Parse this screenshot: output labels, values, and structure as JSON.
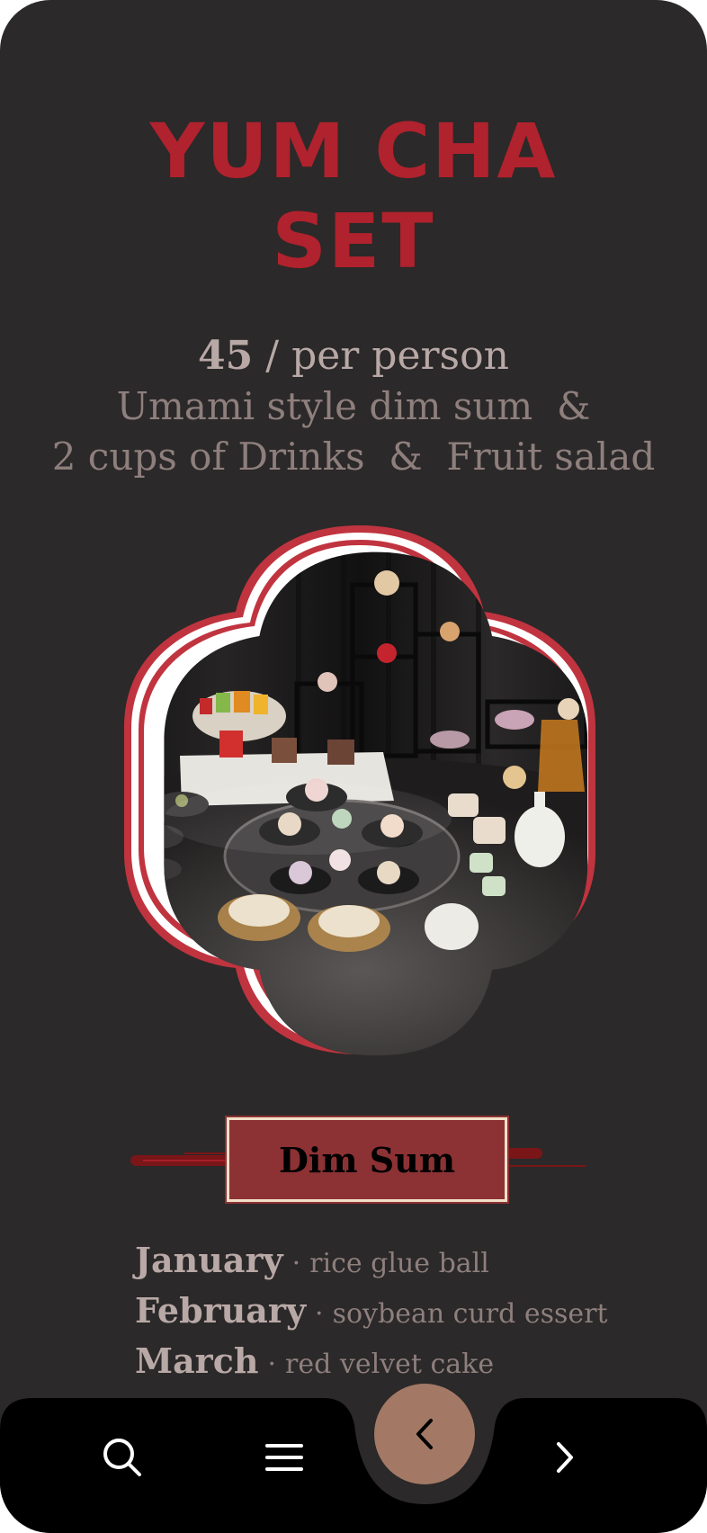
{
  "header": {
    "title_line1": "YUM CHA",
    "title_line2": "SET"
  },
  "pricing": {
    "price": "45",
    "unit": " / per person",
    "desc_line1": "Umami style dim sum  &",
    "desc_line2": "2 cups of Drinks  &  Fruit salad"
  },
  "hero": {
    "image_subject": "dim-sum-set-photo",
    "frame_color": "#b0222d"
  },
  "section": {
    "label": "Dim Sum"
  },
  "menu": [
    {
      "month": "January",
      "separator": "·",
      "dish": "rice glue ball"
    },
    {
      "month": "February",
      "separator": "·",
      "dish": "soybean curd essert"
    },
    {
      "month": "March",
      "separator": "·",
      "dish": "red velvet cake"
    }
  ],
  "nav": {
    "search_icon": "search-icon",
    "menu_icon": "hamburger-menu-icon",
    "back_icon": "chevron-left-icon",
    "next_icon": "chevron-right-icon"
  },
  "colors": {
    "background": "#2b2929",
    "accent_red": "#b0222d",
    "label_bg": "#8c3234",
    "back_button": "#a37966",
    "navbar": "#000000"
  }
}
